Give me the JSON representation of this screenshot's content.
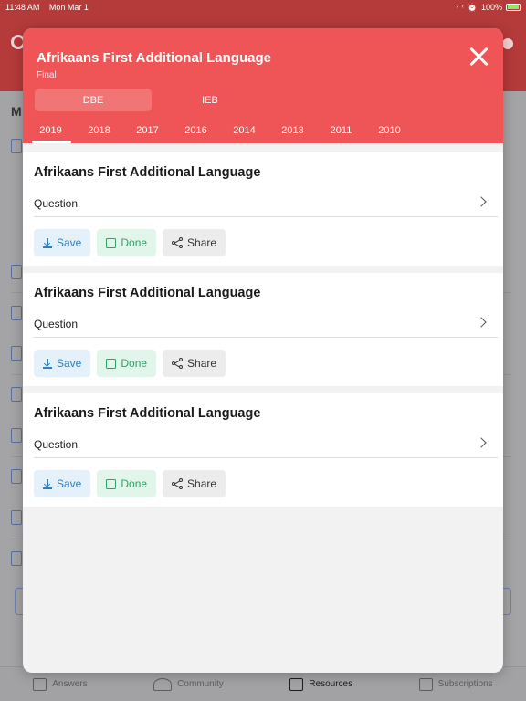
{
  "status_bar": {
    "time": "11:48 AM",
    "date": "Mon Mar 1",
    "battery": "100%"
  },
  "background": {
    "section_letter": "M"
  },
  "tabbar": {
    "items": [
      {
        "label": "Answers",
        "icon": "clipboard-icon"
      },
      {
        "label": "Community",
        "icon": "people-icon"
      },
      {
        "label": "Resources",
        "icon": "folder-icon",
        "active": true
      },
      {
        "label": "Subscriptions",
        "icon": "box-icon"
      }
    ]
  },
  "modal": {
    "title": "Afrikaans First Additional Language",
    "subtitle": "Final",
    "segments": [
      {
        "label": "DBE",
        "active": true
      },
      {
        "label": "IEB",
        "active": false
      }
    ],
    "years": [
      "2019",
      "2018",
      "2017",
      "2016",
      "2014",
      "2013",
      "2011",
      "2010"
    ],
    "selected_year": "2019",
    "cards": [
      {
        "title": "Afrikaans First Additional Language",
        "row_label": "Question"
      },
      {
        "title": "Afrikaans First Additional Language",
        "row_label": "Question"
      },
      {
        "title": "Afrikaans First Additional Language",
        "row_label": "Question"
      }
    ],
    "actions": {
      "save": "Save",
      "done": "Done",
      "share": "Share"
    }
  },
  "colors": {
    "header": "#ef5456",
    "save": "#2f7fc1",
    "done": "#2ba267"
  }
}
